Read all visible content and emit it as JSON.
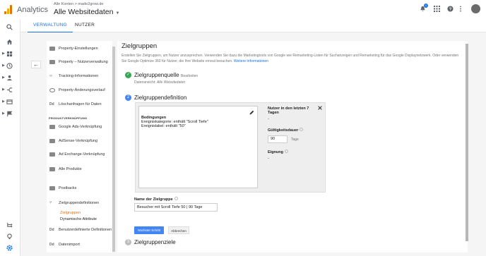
{
  "header": {
    "app_name": "Analytics",
    "breadcrumb": "Alle Konten > made2grow.de",
    "account": "Alle Websitedaten",
    "notification_count": "1"
  },
  "tabs": [
    {
      "label": "VERWALTUNG",
      "active": true
    },
    {
      "label": "NUTZER",
      "active": false
    }
  ],
  "colors": {
    "accent": "#1a73e8",
    "active_link": "#e8710a",
    "success": "#34a853",
    "primary_button": "#4285f4"
  },
  "left_nav_icons": [
    "search-icon",
    "home-icon",
    "customization-icon",
    "realtime-icon",
    "audience-icon",
    "acquisition-icon",
    "behavior-icon",
    "conversions-icon",
    "attribution-icon",
    "discover-icon",
    "admin-icon"
  ],
  "property_nav": {
    "items": [
      {
        "label": "Property-Einstellungen",
        "icon": "settings-icon"
      },
      {
        "label": "Property – Nutzerverwaltung",
        "icon": "users-icon"
      },
      {
        "label": "Tracking-Informationen",
        "icon": "code-icon"
      },
      {
        "label": "Property-Änderungsverlauf",
        "icon": "history-icon"
      },
      {
        "label": "Löschanfragen für Daten",
        "icon": "dd-icon"
      }
    ],
    "section_header": "PRODUKTVERKNÜPFUNG",
    "links": [
      {
        "label": "Google Ads-Verknüpfung",
        "icon": "ads-icon"
      },
      {
        "label": "AdSense-Verknüpfung",
        "icon": "adsense-icon"
      },
      {
        "label": "Ad Exchange-Verknüpfung",
        "icon": "adexchange-icon"
      },
      {
        "label": "Alle Produkte",
        "icon": "products-icon"
      }
    ],
    "more": [
      {
        "label": "Postbacks",
        "icon": "postbacks-icon"
      },
      {
        "label": "Zielgruppendefinitionen",
        "icon": "audience-def-icon"
      }
    ],
    "subitems": [
      {
        "label": "Zielgruppen",
        "active": true
      },
      {
        "label": "Dynamische Attribute",
        "active": false
      }
    ],
    "tail": [
      {
        "label": "Benutzerdefinierte Definitionen",
        "icon": "dd-icon"
      },
      {
        "label": "Datenimport",
        "icon": "dd-icon"
      }
    ]
  },
  "main": {
    "title": "Zielgruppen",
    "description": "Erstellen Sie Zielgruppen, um Nutzer anzusprechen. Verwenden Sie dazu die Marketingtools von Google wie Remarketing-Listen für Suchanzeigen und Remarketing für das Google Displaynetzwerk. Oder verwenden Sie Google Optimize 360 für Nutzer, die Ihre Website erneut besuchen.",
    "more_info_link": "Weitere Informationen",
    "step1": {
      "title": "Zielgruppenquelle",
      "edit_link": "Bearbeiten",
      "subtitle": "Datenansicht:",
      "subtitle_value": "Alle Websitedaten"
    },
    "step2": {
      "number": "2",
      "title": "Zielgruppendefinition"
    },
    "conditions": {
      "heading": "Bedingungen",
      "line1": "Ereigniskategorie: enthält \"Scroll Tiefe\"",
      "line2": "Ereignislabel: enthält \"50\""
    },
    "right": {
      "users_label": "Nutzer in den letzten 7 Tagen",
      "users_value": "-",
      "duration_label": "Gültigkeitsdauer",
      "duration_value": "90",
      "duration_unit": "Tage",
      "eligibility_label": "Eignung",
      "eligibility_value": "-"
    },
    "audience_name_label": "Name der Zielgruppe",
    "audience_name_value": "Besucher mit Scroll Tiefe 50 | 90 Tage",
    "next_button": "Nächster Schritt",
    "cancel_button": "Abbrechen",
    "step3": {
      "number": "3",
      "title": "Zielgruppenziele"
    }
  }
}
